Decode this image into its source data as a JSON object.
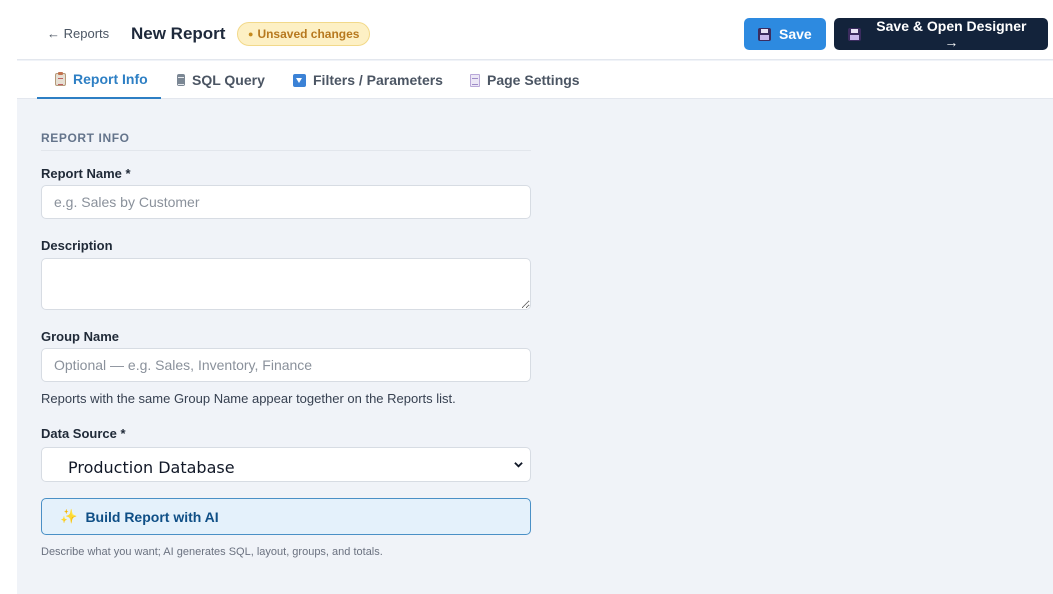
{
  "header": {
    "back_label": "← Reports",
    "title": "New Report",
    "status_badge": "Unsaved changes",
    "save_label": "Save",
    "save_open_label": "Save & Open Designer →"
  },
  "tabs": [
    {
      "label": "Report Info",
      "icon": "clipboard-icon",
      "active": true
    },
    {
      "label": "SQL Query",
      "icon": "database-icon",
      "active": false
    },
    {
      "label": "Filters / Parameters",
      "icon": "filter-icon",
      "active": false
    },
    {
      "label": "Page Settings",
      "icon": "page-icon",
      "active": false
    }
  ],
  "form": {
    "section_title": "REPORT INFO",
    "report_name_label": "Report Name *",
    "report_name_placeholder": "e.g. Sales by Customer",
    "report_name_value": "",
    "description_label": "Description",
    "description_value": "",
    "group_name_label": "Group Name",
    "group_name_placeholder": "Optional — e.g. Sales, Inventory, Finance",
    "group_name_help": "Reports with the same Group Name appear together on the Reports list.",
    "data_source_label": "Data Source *",
    "data_source_value": "Production Database",
    "ai_button_label": "Build Report with AI",
    "ai_help": "Describe what you want; AI generates SQL, layout, groups, and totals."
  },
  "colors": {
    "accent": "#2d8ae0",
    "dark_button": "#13233b",
    "badge_bg": "#fdf0c4",
    "badge_text": "#b7791f",
    "ai_button_bg": "#e4f1fb"
  }
}
